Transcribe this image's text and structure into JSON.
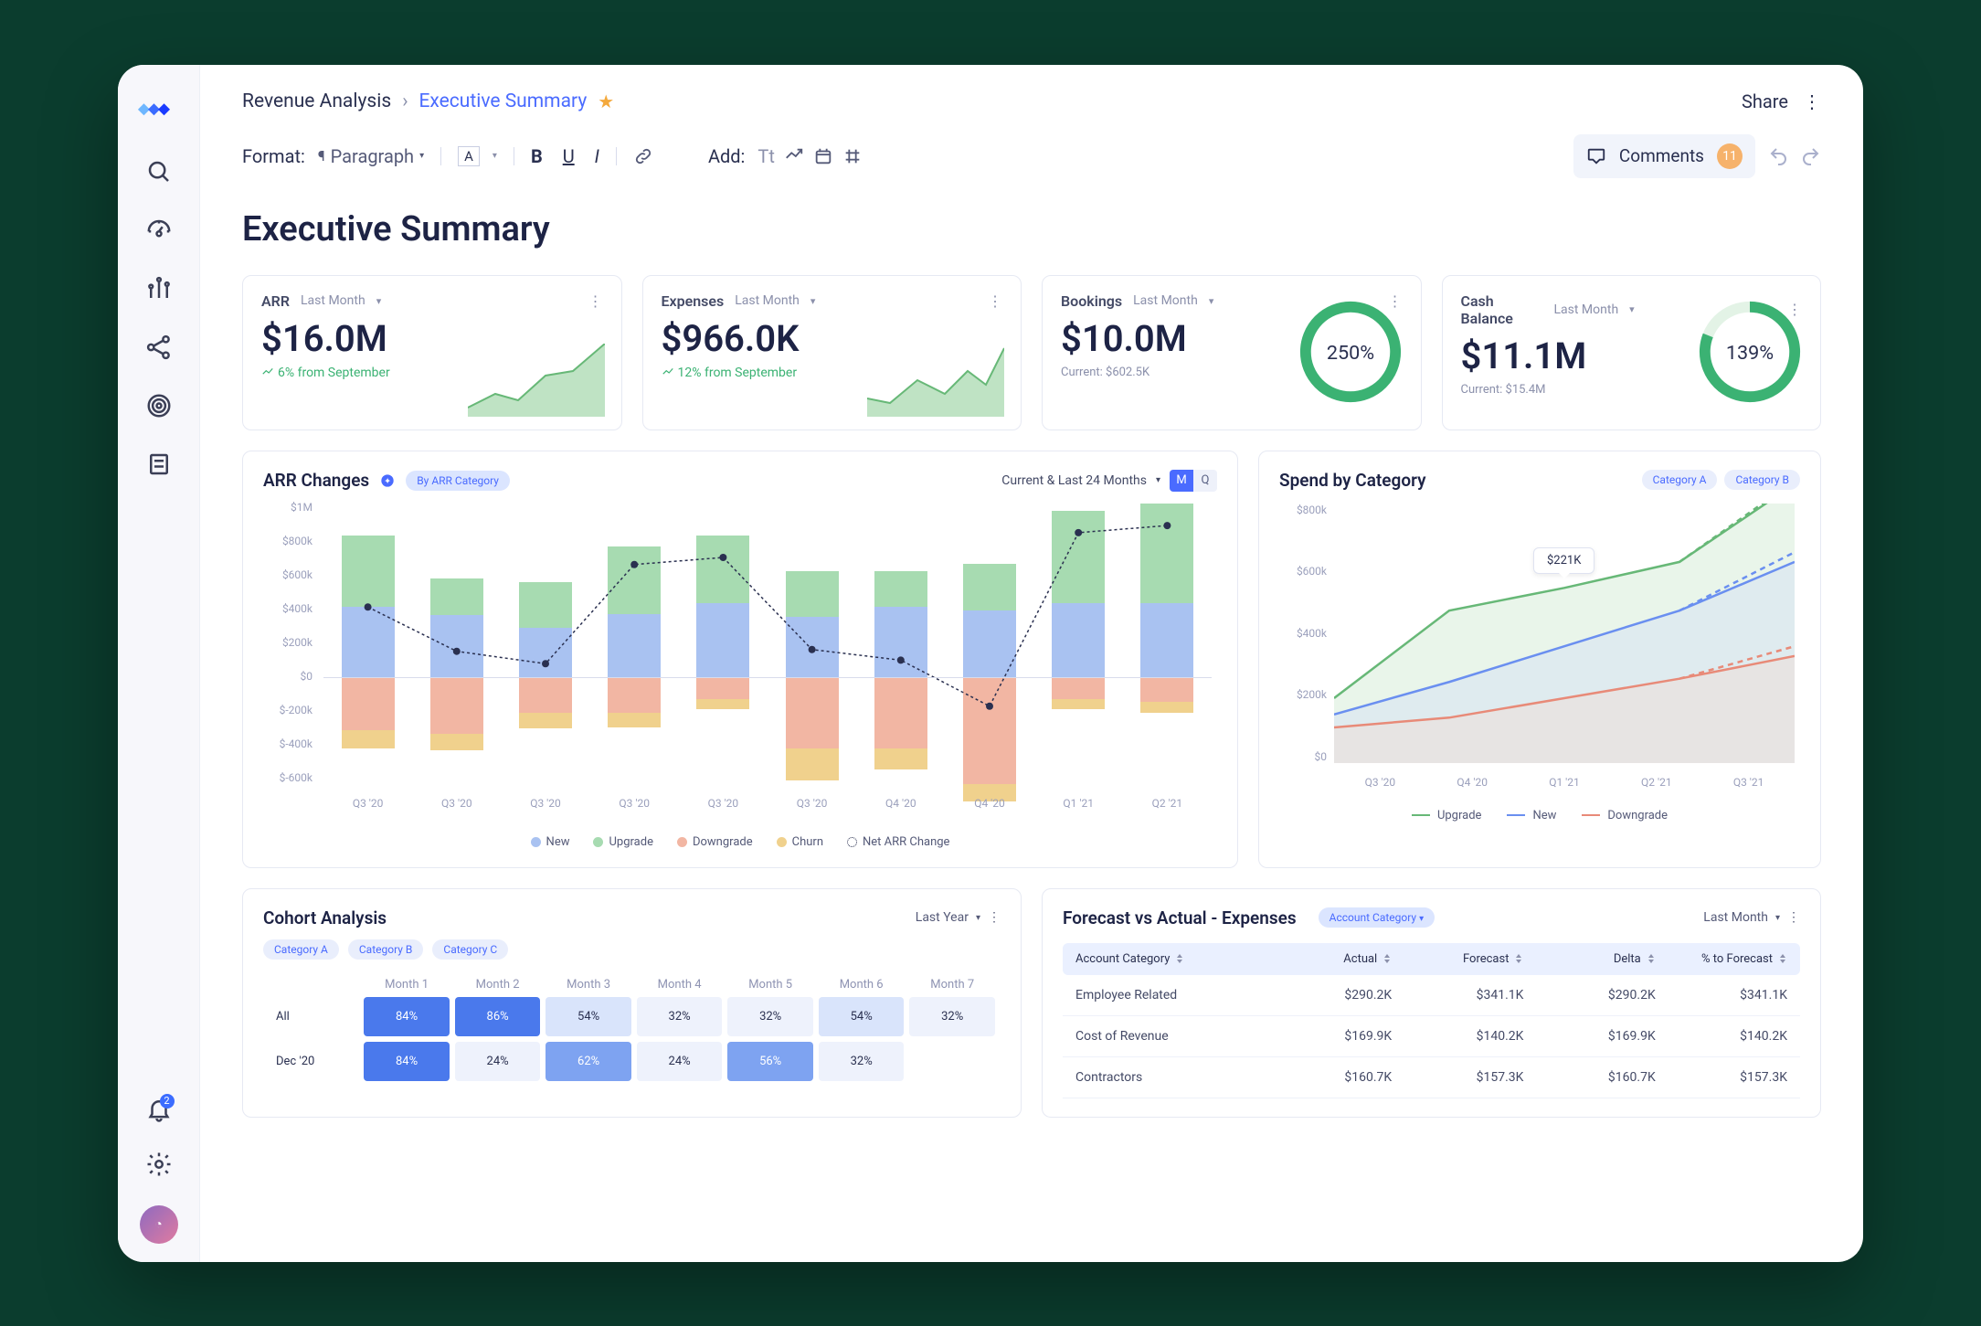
{
  "sidebar": {
    "notifications": "2"
  },
  "breadcrumb": {
    "root": "Revenue Analysis",
    "current": "Executive Summary"
  },
  "header": {
    "share": "Share",
    "format_label": "Format:",
    "paragraph": "Paragraph",
    "add_label": "Add:",
    "comments_label": "Comments",
    "comments_count": "11"
  },
  "page_title": "Executive Summary",
  "kpi": {
    "arr": {
      "title": "ARR",
      "period": "Last Month",
      "value": "$16.0M",
      "delta": "6% from September"
    },
    "expenses": {
      "title": "Expenses",
      "period": "Last Month",
      "value": "$966.0K",
      "delta": "12% from September"
    },
    "bookings": {
      "title": "Bookings",
      "period": "Last Month",
      "value": "$10.0M",
      "current": "Current:  $602.5K",
      "gauge": "250%"
    },
    "cash": {
      "title": "Cash Balance",
      "period": "Last Month",
      "value": "$11.1M",
      "current": "Current:  $15.4M",
      "gauge": "139%"
    }
  },
  "arr_changes": {
    "title": "ARR Changes",
    "pill": "By ARR Category",
    "range_label": "Current & Last 24 Months",
    "seg": [
      "M",
      "Q"
    ],
    "legend": {
      "new": "New",
      "upgrade": "Upgrade",
      "downgrade": "Downgrade",
      "churn": "Churn",
      "net": "Net ARR Change"
    }
  },
  "spend": {
    "title": "Spend by Category",
    "pills": [
      "Category A",
      "Category B"
    ],
    "tooltip": "$221K",
    "legend": {
      "upgrade": "Upgrade",
      "new": "New",
      "downgrade": "Downgrade"
    }
  },
  "cohort": {
    "title": "Cohort Analysis",
    "range": "Last Year",
    "pills": [
      "Category A",
      "Category B",
      "Category C"
    ]
  },
  "fva": {
    "title": "Forecast vs Actual - Expenses",
    "pill": "Account Category",
    "range": "Last Month"
  },
  "chart_data": [
    {
      "id": "arr_changes",
      "type": "bar",
      "y_ticks": [
        "$1M",
        "$800k",
        "$600k",
        "$400k",
        "$200k",
        "$0",
        "$-200k",
        "$-400k",
        "$-600k"
      ],
      "categories": [
        "Q3 '20",
        "Q3 '20",
        "Q3 '20",
        "Q3 '20",
        "Q3 '20",
        "Q3 '20",
        "Q4 '20",
        "Q4 '20",
        "Q1 '21",
        "Q2 '21"
      ],
      "series": [
        {
          "name": "New",
          "values": [
            400,
            350,
            280,
            360,
            420,
            340,
            400,
            380,
            420,
            420
          ]
        },
        {
          "name": "Upgrade",
          "values": [
            400,
            210,
            260,
            380,
            380,
            260,
            200,
            260,
            520,
            560
          ]
        },
        {
          "name": "Downgrade",
          "values": [
            -300,
            -320,
            -200,
            -200,
            -120,
            -400,
            -400,
            -600,
            -120,
            -140
          ]
        },
        {
          "name": "Churn",
          "values": [
            -100,
            -90,
            -90,
            -80,
            -60,
            -180,
            -120,
            -100,
            -60,
            -60
          ]
        },
        {
          "name": "Net ARR Change",
          "values": [
            400,
            150,
            80,
            640,
            680,
            160,
            100,
            -160,
            820,
            860
          ]
        }
      ],
      "ylim": [
        -600,
        1000
      ]
    },
    {
      "id": "spend_by_category",
      "type": "line",
      "y_ticks": [
        "$800k",
        "$600k",
        "$400k",
        "$200k",
        "$0"
      ],
      "categories": [
        "Q3 '20",
        "Q4 '20",
        "Q1 '21",
        "Q2 '21",
        "Q3 '21"
      ],
      "series": [
        {
          "name": "Upgrade",
          "values": [
            200,
            470,
            540,
            620,
            860
          ],
          "forecast_last": 870
        },
        {
          "name": "New",
          "values": [
            150,
            250,
            360,
            470,
            620
          ],
          "forecast_last": 650
        },
        {
          "name": "Downgrade",
          "values": [
            110,
            140,
            200,
            260,
            330
          ],
          "forecast_last": 360
        }
      ],
      "annotation": {
        "label": "$221K",
        "x": "Q1 '21"
      },
      "ylim": [
        0,
        800
      ]
    },
    {
      "id": "cohort_analysis",
      "type": "heatmap",
      "columns": [
        "Month 1",
        "Month 2",
        "Month 3",
        "Month 4",
        "Month 5",
        "Month 6",
        "Month 7"
      ],
      "rows": [
        {
          "label": "All",
          "values": [
            "84%",
            "86%",
            "54%",
            "32%",
            "32%",
            "54%",
            "32%"
          ]
        },
        {
          "label": "Dec '20",
          "values": [
            "84%",
            "24%",
            "62%",
            "24%",
            "56%",
            "32%",
            ""
          ]
        }
      ]
    },
    {
      "id": "forecast_vs_actual",
      "type": "table",
      "columns": [
        "Account Category",
        "Actual",
        "Forecast",
        "Delta",
        "% to Forecast"
      ],
      "rows": [
        [
          "Employee Related",
          "$290.2K",
          "$341.1K",
          "$290.2K",
          "$341.1K"
        ],
        [
          "Cost of Revenue",
          "$169.9K",
          "$140.2K",
          "$169.9K",
          "$140.2K"
        ],
        [
          "Contractors",
          "$160.7K",
          "$157.3K",
          "$160.7K",
          "$157.3K"
        ]
      ]
    }
  ]
}
